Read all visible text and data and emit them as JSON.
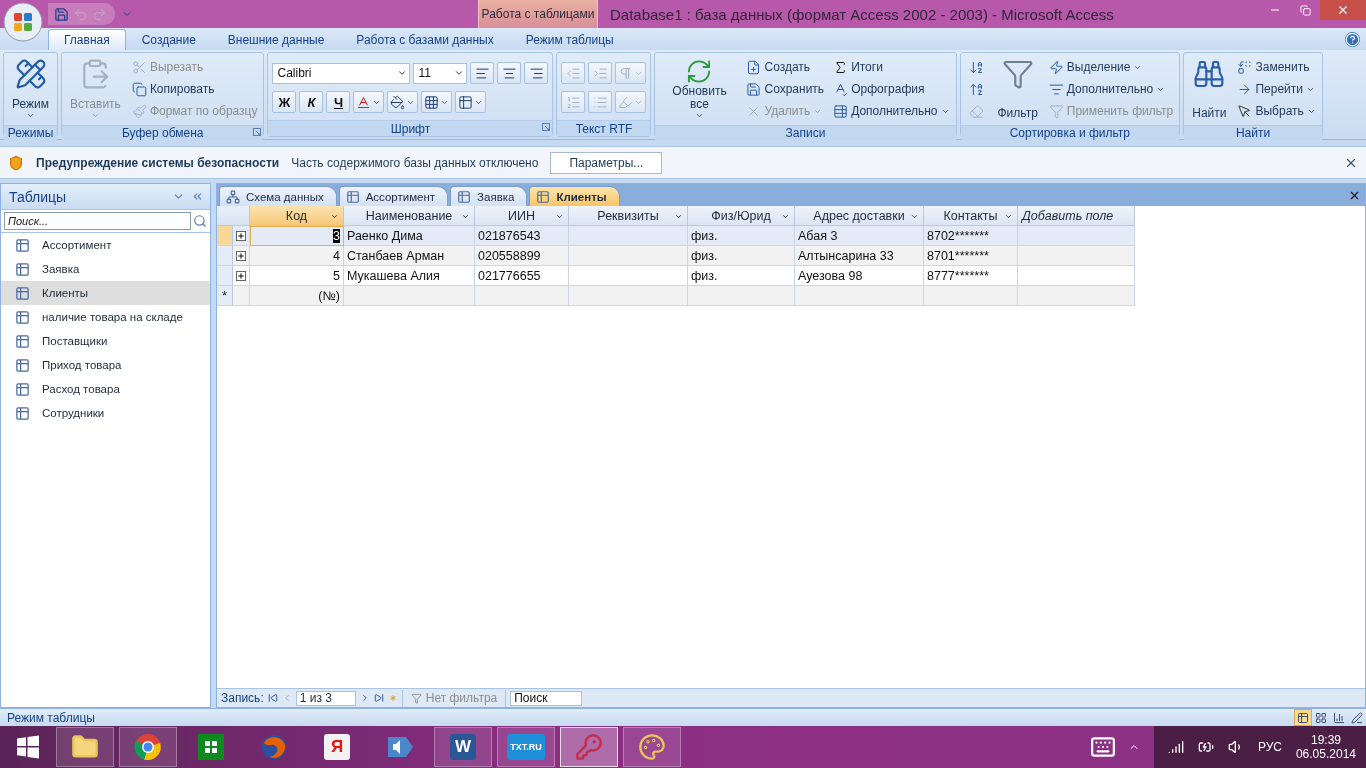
{
  "window": {
    "context_tab": "Работа с таблицами",
    "title": "Database1 : база данных (формат Access 2002 - 2003)  -  Microsoft Access"
  },
  "ribbon_tabs": [
    {
      "label": "Главная",
      "selected": true
    },
    {
      "label": "Создание",
      "selected": false
    },
    {
      "label": "Внешние данные",
      "selected": false
    },
    {
      "label": "Работа с базами данных",
      "selected": false
    },
    {
      "label": "Режим таблицы",
      "selected": false
    }
  ],
  "ribbon_groups": [
    {
      "title": "Режимы",
      "launcher": false,
      "items": [
        {
          "kind": "large",
          "label": "Режим",
          "disabled": false,
          "menu": true
        }
      ]
    },
    {
      "title": "Буфер обмена",
      "launcher": true,
      "items": [
        {
          "kind": "large",
          "label": "Вставить",
          "disabled": true,
          "menu": true
        },
        {
          "kind": "small",
          "label": "Вырезать",
          "disabled": true,
          "menu": false
        },
        {
          "kind": "small",
          "label": "Копировать",
          "disabled": false,
          "menu": false
        },
        {
          "kind": "small",
          "label": "Формат по образцу",
          "disabled": true,
          "menu": false
        }
      ]
    },
    {
      "title": "Шрифт",
      "launcher": true,
      "rows": [
        [
          {
            "kind": "field",
            "value": "Calibri"
          },
          {
            "kind": "field",
            "value": "11"
          },
          {
            "kind": "icon",
            "disabled": false,
            "menu": false
          },
          {
            "kind": "icon",
            "disabled": false,
            "menu": false
          },
          {
            "kind": "icon",
            "disabled": false,
            "menu": false
          }
        ],
        [
          {
            "kind": "glyph",
            "label": "Ж",
            "disabled": false,
            "menu": false
          },
          {
            "kind": "glyph",
            "label": "К",
            "disabled": false,
            "menu": false
          },
          {
            "kind": "glyph",
            "label": "Ч",
            "disabled": false,
            "menu": false
          },
          {
            "kind": "icon",
            "disabled": false,
            "menu": true
          },
          {
            "kind": "icon",
            "disabled": false,
            "menu": true
          },
          {
            "kind": "icon",
            "disabled": false,
            "menu": true
          },
          {
            "kind": "icon",
            "disabled": false,
            "menu": true
          }
        ]
      ]
    },
    {
      "title": "Текст RTF",
      "launcher": false,
      "rows": [
        [
          {
            "kind": "icon",
            "disabled": true,
            "menu": false
          },
          {
            "kind": "icon",
            "disabled": true,
            "menu": false
          },
          {
            "kind": "icon",
            "disabled": true,
            "menu": true
          }
        ],
        [
          {
            "kind": "icon",
            "disabled": true,
            "menu": false
          },
          {
            "kind": "icon",
            "disabled": true,
            "menu": false
          },
          {
            "kind": "icon",
            "disabled": true,
            "menu": true
          }
        ]
      ]
    },
    {
      "title": "Записи",
      "launcher": false,
      "items": [
        {
          "kind": "large",
          "label": "Обновить все",
          "disabled": false,
          "menu": true
        },
        {
          "kind": "small",
          "label": "Создать",
          "disabled": false,
          "menu": false
        },
        {
          "kind": "small",
          "label": "Сохранить",
          "disabled": false,
          "menu": false
        },
        {
          "kind": "small",
          "label": "Удалить",
          "disabled": true,
          "menu": true
        },
        {
          "kind": "small",
          "label": "Итоги",
          "disabled": false,
          "menu": false
        },
        {
          "kind": "small",
          "label": "Орфография",
          "disabled": false,
          "menu": false
        },
        {
          "kind": "small",
          "label": "Дополнительно",
          "disabled": false,
          "menu": true
        }
      ]
    },
    {
      "title": "Сортировка и фильтр",
      "launcher": false,
      "items": [
        {
          "kind": "icon",
          "disabled": false,
          "menu": false
        },
        {
          "kind": "icon",
          "disabled": false,
          "menu": false
        },
        {
          "kind": "icon",
          "disabled": true,
          "menu": false
        },
        {
          "kind": "large",
          "label": "Фильтр",
          "disabled": false,
          "menu": false
        },
        {
          "kind": "small",
          "label": "Выделение",
          "disabled": false,
          "menu": true
        },
        {
          "kind": "small",
          "label": "Дополнительно",
          "disabled": false,
          "menu": true
        },
        {
          "kind": "small",
          "label": "Применить фильтр",
          "disabled": true,
          "menu": false
        }
      ]
    },
    {
      "title": "Найти",
      "launcher": false,
      "items": [
        {
          "kind": "large",
          "label": "Найти",
          "disabled": false,
          "menu": false
        },
        {
          "kind": "small",
          "label": "Заменить",
          "disabled": false,
          "menu": false
        },
        {
          "kind": "small",
          "label": "Перейти",
          "disabled": false,
          "menu": true
        },
        {
          "kind": "small",
          "label": "Выбрать",
          "disabled": false,
          "menu": true
        }
      ]
    }
  ],
  "security_bar": {
    "title": "Предупреждение системы безопасности",
    "message": "Часть содержимого базы данных отключено",
    "button": "Параметры..."
  },
  "navigation": {
    "title": "Таблицы",
    "search": {
      "placeholder": "Поиск..."
    },
    "items": [
      {
        "label": "Ассортимент",
        "selected": false
      },
      {
        "label": "Заявка",
        "selected": false
      },
      {
        "label": "Клиенты",
        "selected": true
      },
      {
        "label": "наличие товара на складе",
        "selected": false
      },
      {
        "label": "Поставщики",
        "selected": false
      },
      {
        "label": "Приход товара",
        "selected": false
      },
      {
        "label": "Расход товара",
        "selected": false
      },
      {
        "label": "Сотрудники",
        "selected": false
      }
    ]
  },
  "document_tabs": [
    {
      "label": "Схема данных",
      "kind": "diagram",
      "selected": false
    },
    {
      "label": "Ассортимент",
      "kind": "table",
      "selected": false
    },
    {
      "label": "Заявка",
      "kind": "table",
      "selected": false
    },
    {
      "label": "Клиенты",
      "kind": "table",
      "selected": true
    }
  ],
  "datasheet": {
    "columns": [
      {
        "label": "Код",
        "kind": "field",
        "selected": true
      },
      {
        "label": "Наименование",
        "kind": "field",
        "selected": false
      },
      {
        "label": "ИИН",
        "kind": "field",
        "selected": false
      },
      {
        "label": "Реквизиты",
        "kind": "field",
        "selected": false
      },
      {
        "label": "Физ/Юрид",
        "kind": "field",
        "selected": false
      },
      {
        "label": "Адрес доставки",
        "kind": "field",
        "selected": false
      },
      {
        "label": "Контакты",
        "kind": "field",
        "selected": false
      },
      {
        "label": "Добавить поле",
        "kind": "add",
        "selected": false
      }
    ],
    "rows": [
      {
        "selected": true,
        "cells": [
          "3",
          "Раенко Дима",
          "021876543",
          null,
          "физ.",
          "Абая 3",
          "8702*******",
          null
        ]
      },
      {
        "selected": false,
        "cells": [
          "4",
          "Станбаев Арман",
          "020558899",
          null,
          "физ.",
          "Алтынсарина 33",
          "8701*******",
          null
        ]
      },
      {
        "selected": false,
        "cells": [
          "5",
          "Мукашева Алия",
          "021776655",
          null,
          "физ.",
          "Ауезова 98",
          "8777*******",
          null
        ]
      }
    ],
    "new_row": {
      "marker": "*",
      "cells": [
        "(№)",
        null,
        null,
        null,
        null,
        null,
        null,
        null
      ]
    }
  },
  "record_navigator": {
    "label": "Запись:",
    "position": "1 из 3",
    "filter": "Нет фильтра",
    "search": {
      "placeholder": "Поиск"
    }
  },
  "status_bar": {
    "text": "Режим таблицы",
    "views": [
      {
        "selected": true
      },
      {
        "selected": false
      },
      {
        "selected": false
      },
      {
        "selected": false
      }
    ]
  },
  "taskbar": {
    "apps": [
      {
        "running": true,
        "selected": false
      },
      {
        "running": true,
        "selected": false
      },
      {
        "running": false,
        "selected": false
      },
      {
        "running": false,
        "selected": false
      },
      {
        "running": false,
        "selected": false,
        "badge": "Я"
      },
      {
        "running": false,
        "selected": false
      },
      {
        "running": true,
        "selected": false,
        "badge": "W"
      },
      {
        "running": true,
        "selected": false,
        "badge": "TXT.RU"
      },
      {
        "running": true,
        "selected": true
      },
      {
        "running": true,
        "selected": false
      }
    ],
    "language": "РУС",
    "time": "19:39",
    "date": "06.05.2014"
  }
}
